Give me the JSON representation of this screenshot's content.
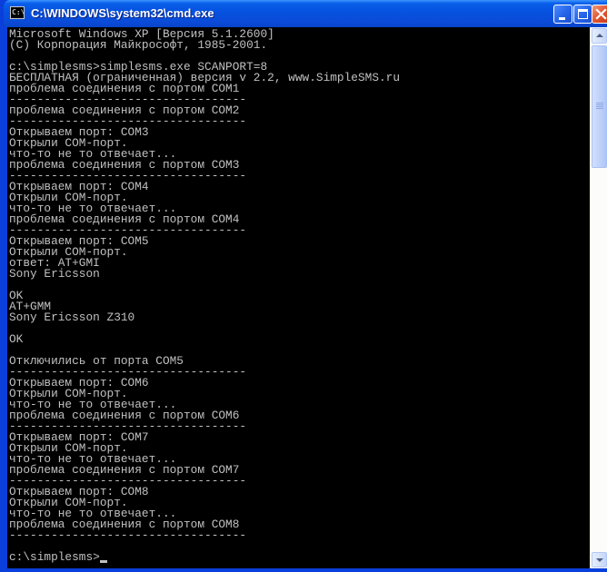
{
  "window": {
    "title": "C:\\WINDOWS\\system32\\cmd.exe",
    "icon_label": "C:\\"
  },
  "titlebar_buttons": {
    "minimize": "minimize-icon",
    "maximize": "maximize-icon",
    "close": "close-icon"
  },
  "console": {
    "lines": [
      "Microsoft Windows XP [Версия 5.1.2600]",
      "(С) Корпорация Майкрософт, 1985-2001.",
      "",
      "c:\\simplesms>simplesms.exe SCANPORT=8",
      "БЕСПЛАТНАЯ (ограниченная) версия v 2.2, www.SimpleSMS.ru",
      "проблема соединения с портом COM1",
      "----------------------------------",
      "проблема соединения с портом COM2",
      "----------------------------------",
      "Открываем порт: COM3",
      "Открыли COM-порт.",
      "что-то не то отвечает...",
      "проблема соединения с портом COM3",
      "----------------------------------",
      "Открываем порт: COM4",
      "Открыли COM-порт.",
      "что-то не то отвечает...",
      "проблема соединения с портом COM4",
      "----------------------------------",
      "Открываем порт: COM5",
      "Открыли COM-порт.",
      "ответ: AT+GMI",
      "Sony Ericsson",
      "",
      "OK",
      "AT+GMM",
      "Sony Ericsson Z310",
      "",
      "OK",
      "",
      "Отключились от порта COM5",
      "----------------------------------",
      "Открываем порт: COM6",
      "Открыли COM-порт.",
      "что-то не то отвечает...",
      "проблема соединения с портом COM6",
      "----------------------------------",
      "Открываем порт: COM7",
      "Открыли COM-порт.",
      "что-то не то отвечает...",
      "проблема соединения с портом COM7",
      "----------------------------------",
      "Открываем порт: COM8",
      "Открыли COM-порт.",
      "что-то не то отвечает...",
      "проблема соединения с портом COM8",
      "----------------------------------",
      "",
      "c:\\simplesms>"
    ]
  },
  "colors": {
    "console_bg": "#000000",
    "console_fg": "#C0C0C0",
    "titlebar": "#0A5FEA",
    "close_button": "#E2542F"
  },
  "scrollbar": {
    "orientation": "vertical",
    "up_icon": "scroll-up-arrow-icon",
    "down_icon": "scroll-down-arrow-icon"
  }
}
